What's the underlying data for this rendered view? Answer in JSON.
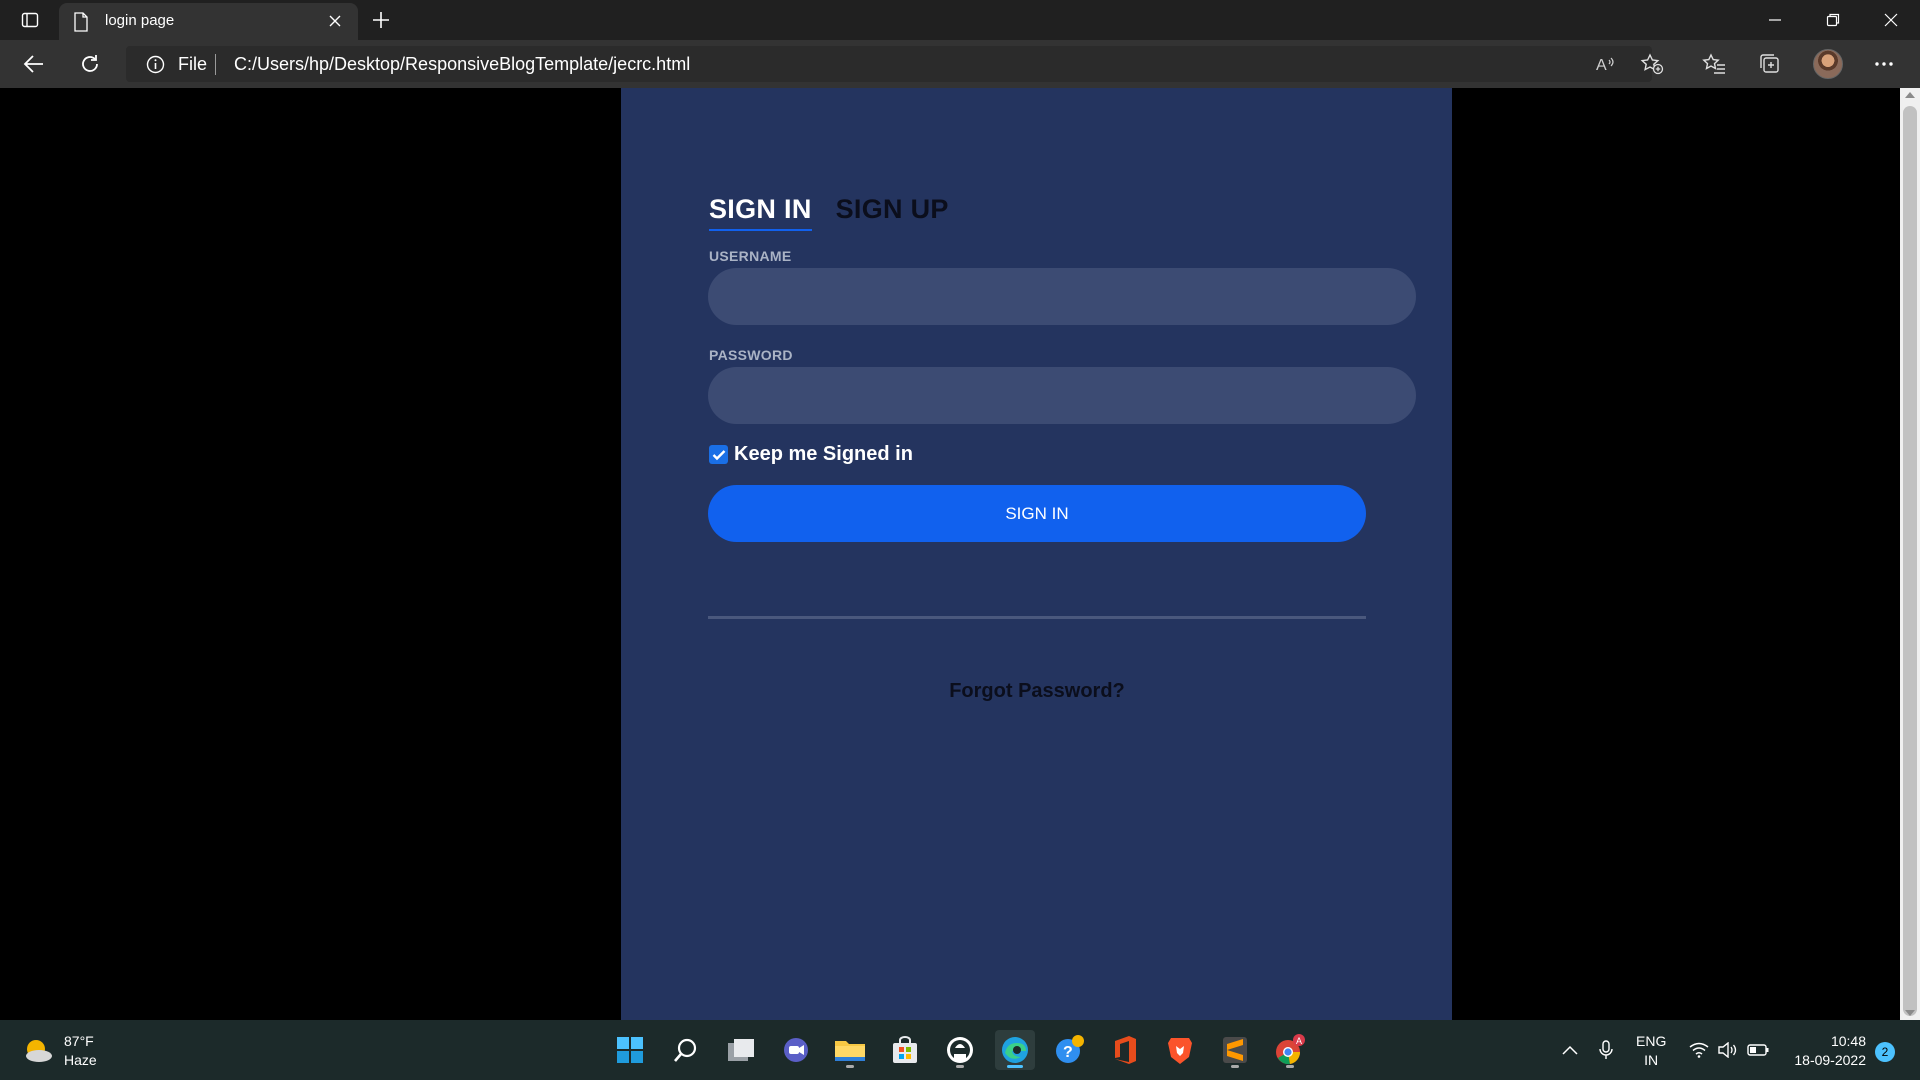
{
  "browser": {
    "tab_title": "login page",
    "address_prefix": "File",
    "url": "C:/Users/hp/Desktop/ResponsiveBlogTemplate/jecrc.html"
  },
  "login": {
    "tab_sign_in": "SIGN IN",
    "tab_sign_up": "SIGN UP",
    "username_label": "USERNAME",
    "username_value": "",
    "password_label": "PASSWORD",
    "password_value": "",
    "keep_signed_in_label": "Keep me Signed in",
    "keep_signed_in_checked": true,
    "sign_in_button": "SIGN IN",
    "forgot_password": "Forgot Password?"
  },
  "taskbar": {
    "temperature": "87°F",
    "weather_condition": "Haze",
    "language_line1": "ENG",
    "language_line2": "IN",
    "time": "10:48",
    "date": "18-09-2022",
    "notification_count": "2",
    "apps": [
      "start",
      "search",
      "task-view",
      "teams-chat",
      "file-explorer",
      "store",
      "github",
      "edge",
      "help",
      "office",
      "brave",
      "sublime-text",
      "chrome"
    ]
  },
  "colors": {
    "card_bg": "#24345f",
    "input_bg": "#3c4b73",
    "accent": "#1161ee",
    "chrome_dark": "#202020",
    "chrome_toolbar": "#333333",
    "taskbar_bg": "#1c2a2a"
  }
}
